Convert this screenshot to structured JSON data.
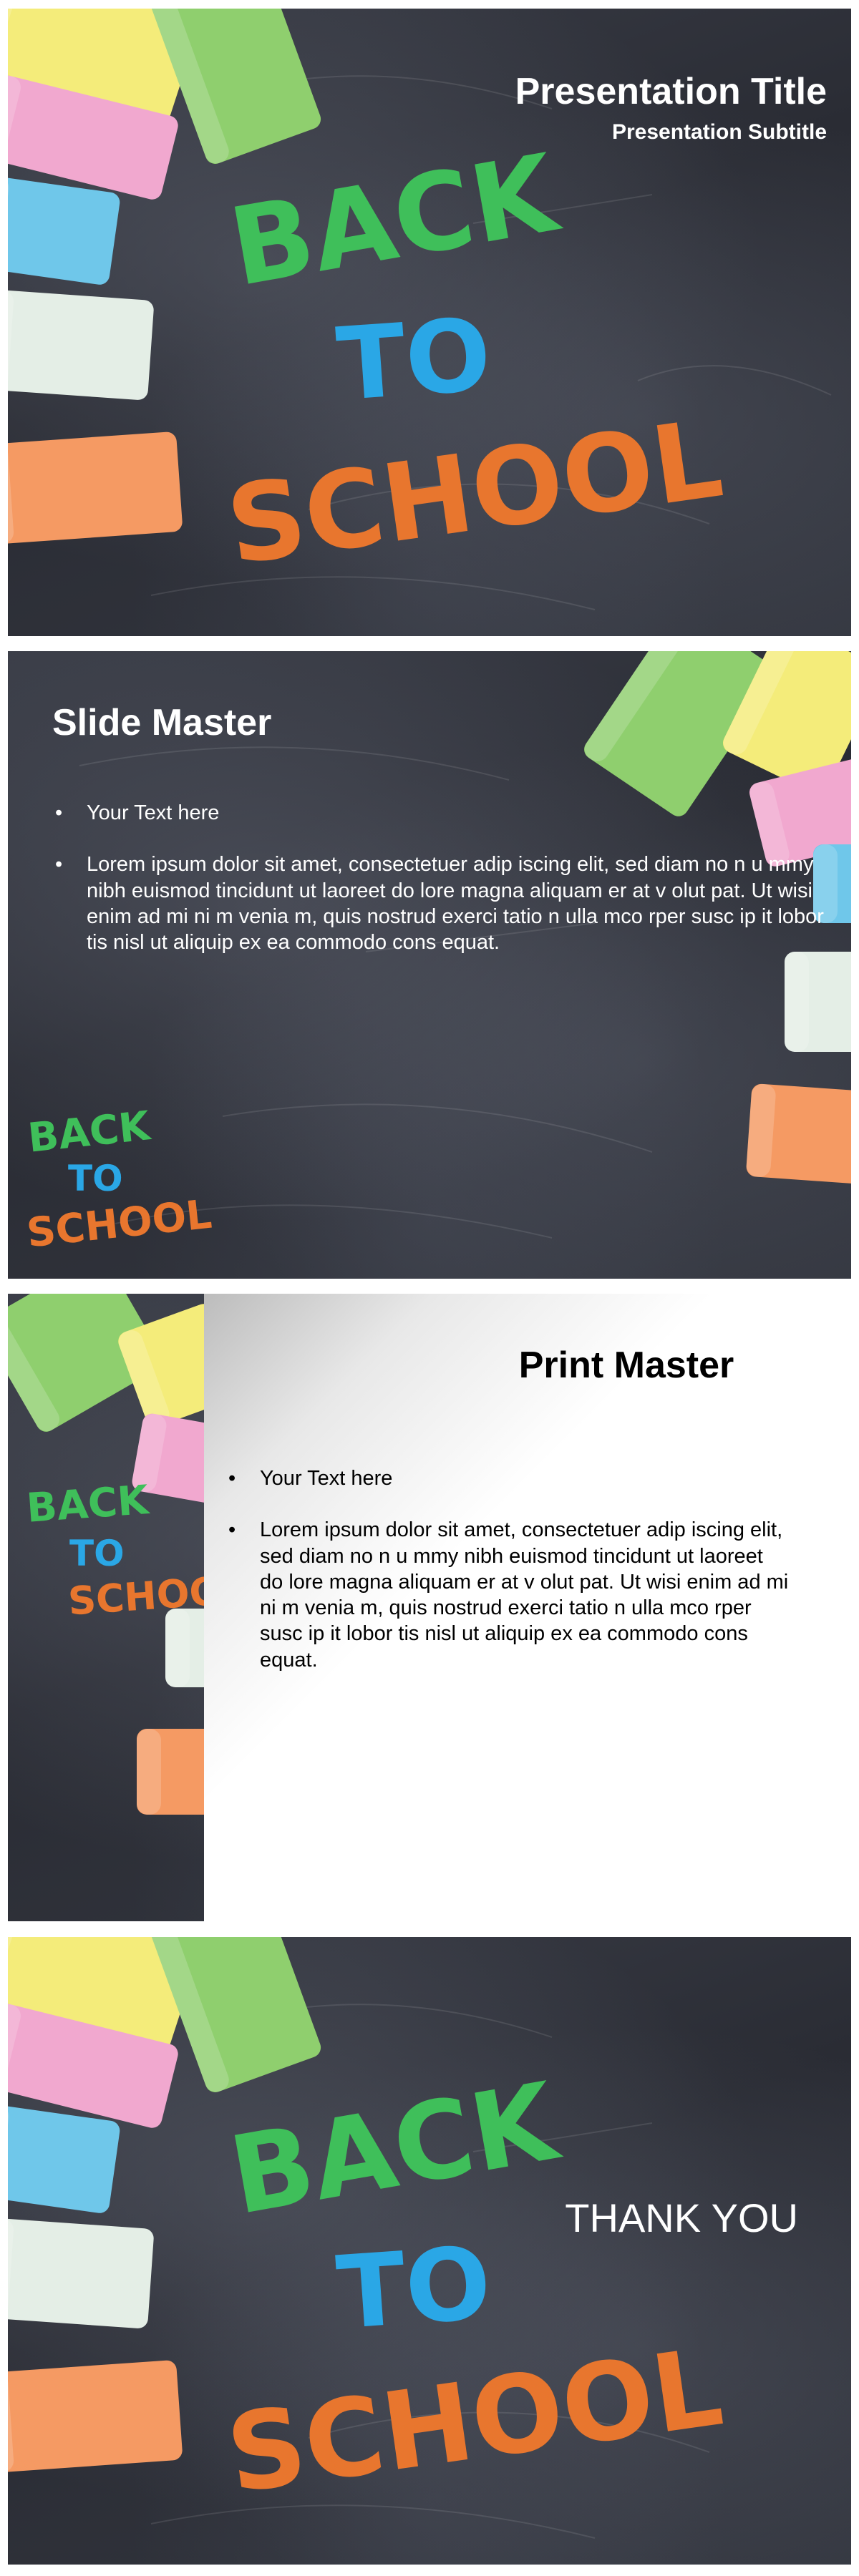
{
  "slides": [
    {
      "id": "title-slide",
      "title": "Presentation Title",
      "subtitle": "Presentation Subtitle",
      "chalk_lettering": [
        "BACK",
        "TO",
        "SCHOOL"
      ]
    },
    {
      "id": "slide-master",
      "title": "Slide Master",
      "bullets": [
        "Your Text here",
        "Lorem ipsum dolor sit amet, consectetuer adip iscing elit, sed diam no n u mmy nibh euismod tincidunt ut laoreet do lore magna aliquam er at v olut pat. Ut wisi enim ad mi ni m venia m, quis nostrud exerci tatio n ulla mco rper susc ip it lobor tis nisl ut aliquip ex ea commodo cons equat."
      ],
      "chalk_lettering": [
        "BACK",
        "TO",
        "SCHOOL"
      ]
    },
    {
      "id": "print-master",
      "title": "Print Master",
      "bullets": [
        "Your Text here",
        "Lorem ipsum dolor sit amet, consectetuer adip iscing elit, sed diam no n u mmy nibh euismod tincidunt ut laoreet do lore magna aliquam er at v olut pat. Ut wisi enim ad mi ni m venia m, quis nostrud exerci tatio n ulla mco rper susc ip it lobor tis nisl ut aliquip ex ea commodo cons equat."
      ],
      "chalk_lettering": [
        "BACK",
        "TO",
        "SCHOOL"
      ]
    },
    {
      "id": "closing-slide",
      "title": "THANK YOU",
      "chalk_lettering": [
        "BACK",
        "TO",
        "SCHOOL"
      ]
    }
  ],
  "bullet_glyph": "•",
  "colors": {
    "chalkboard": "#2b2d35",
    "chalk_yellow": "#f4ec7a",
    "chalk_green": "#8fcf6e",
    "chalk_pink": "#f1a8cf",
    "chalk_blue": "#6fc7ea",
    "chalk_white": "#e4eee6",
    "chalk_orange": "#f59a63",
    "letter_green": "#3fbf5a",
    "letter_blue": "#2aa7e6",
    "letter_orange": "#e8762e",
    "text_light": "#ffffff",
    "text_dark": "#000000"
  }
}
